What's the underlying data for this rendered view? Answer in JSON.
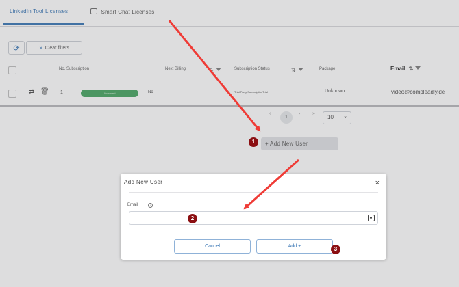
{
  "tabs": [
    {
      "label": "LinkedIn Tool Licenses",
      "active": true
    },
    {
      "label": "Smart Chat Licenses",
      "active": false
    }
  ],
  "toolbar": {
    "refresh_icon": "refresh-icon",
    "clear_filters_label": "Clear filters"
  },
  "table": {
    "columns": [
      "No. Subscription",
      "Next Billing",
      "Subscription Status",
      "Package",
      "Email"
    ],
    "row": {
      "number": "1",
      "status_badge": "Abonniert",
      "no": "No",
      "subscription": "Trial Party SubscriptionTrial",
      "package": "Unknown",
      "email": "video@compleadly.de"
    }
  },
  "pagination": {
    "prev_first": "‹",
    "current_page": "1",
    "next": "›",
    "last": "»",
    "page_size": "10"
  },
  "add_user_button": "+ Add New User",
  "modal": {
    "title": "Add New User",
    "close": "×",
    "email_label": "Email",
    "email_value": "",
    "cancel_label": "Cancel",
    "add_label": "Add +"
  },
  "markers": [
    "1",
    "2",
    "3"
  ],
  "colors": {
    "accent": "#2f6fb1",
    "badge_green": "#3ea15a",
    "marker_red": "#8b0f12",
    "arrow_red": "#ef3b36"
  }
}
